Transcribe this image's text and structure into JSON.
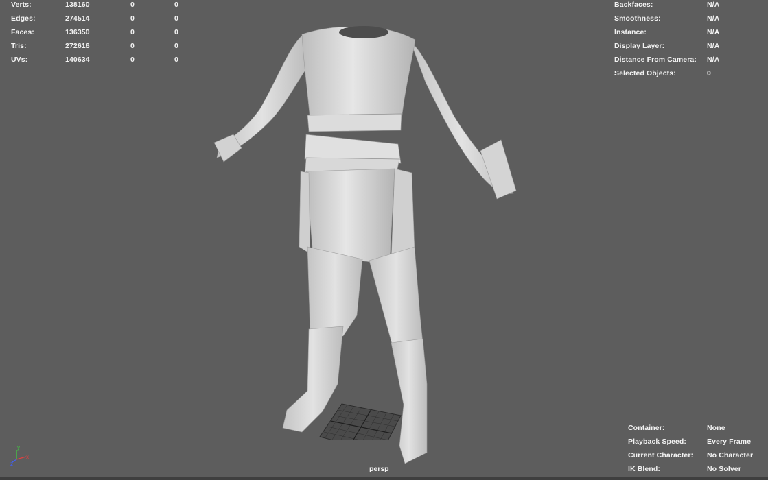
{
  "poly_stats": [
    {
      "label": "Verts:",
      "values": [
        "138160",
        "0",
        "0"
      ]
    },
    {
      "label": "Edges:",
      "values": [
        "274514",
        "0",
        "0"
      ]
    },
    {
      "label": "Faces:",
      "values": [
        "136350",
        "0",
        "0"
      ]
    },
    {
      "label": "Tris:",
      "values": [
        "272616",
        "0",
        "0"
      ]
    },
    {
      "label": "UVs:",
      "values": [
        "140634",
        "0",
        "0"
      ]
    }
  ],
  "object_info": [
    {
      "label": "Backfaces:",
      "value": "N/A"
    },
    {
      "label": "Smoothness:",
      "value": "N/A"
    },
    {
      "label": "Instance:",
      "value": "N/A"
    },
    {
      "label": "Display Layer:",
      "value": "N/A"
    },
    {
      "label": "Distance From Camera:",
      "value": "N/A"
    },
    {
      "label": "Selected Objects:",
      "value": "0"
    }
  ],
  "scene_info": [
    {
      "label": "Container:",
      "value": "None"
    },
    {
      "label": "Playback Speed:",
      "value": "Every Frame"
    },
    {
      "label": "Current Character:",
      "value": "No Character"
    },
    {
      "label": "IK Blend:",
      "value": "No Solver"
    }
  ],
  "camera": {
    "name": "persp"
  },
  "axis": {
    "y": "y",
    "x": "x",
    "z": "z"
  },
  "colors": {
    "background": "#5d5d5d",
    "model": "#dadada",
    "hud_text": "#f2f2f2",
    "axis_x": "#e04040",
    "axis_y": "#40d040",
    "axis_z": "#4060ff"
  }
}
